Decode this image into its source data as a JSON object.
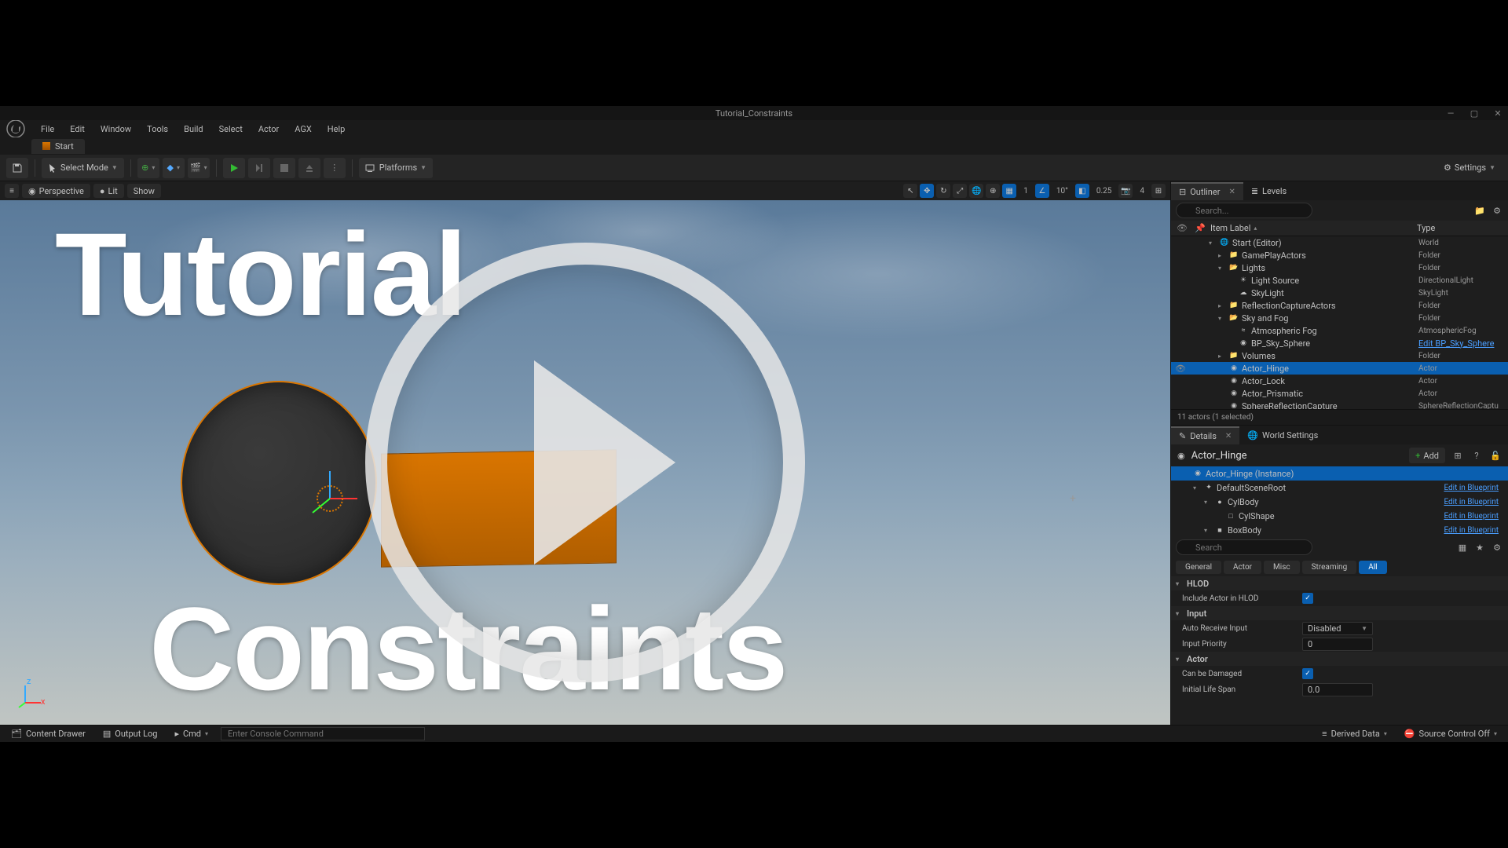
{
  "title": "Tutorial_Constraints",
  "menus": [
    "File",
    "Edit",
    "Window",
    "Tools",
    "Build",
    "Select",
    "Actor",
    "AGX",
    "Help"
  ],
  "level_tab": "Start",
  "toolbar": {
    "save_tip": "Save",
    "select_mode": "Select Mode",
    "platforms": "Platforms",
    "settings": "Settings"
  },
  "viewport": {
    "perspective": "Perspective",
    "lit": "Lit",
    "show": "Show",
    "snap_angle": "10°",
    "snap_scale": "0.25",
    "cams": "4",
    "grid": "1",
    "overlay_top": "Tutorial",
    "overlay_bottom": "Constraints"
  },
  "outliner": {
    "tab": "Outliner",
    "levels_tab": "Levels",
    "search_ph": "Search...",
    "col_item": "Item Label",
    "col_type": "Type",
    "rows": [
      {
        "d": 1,
        "exp": "▾",
        "icon": "world",
        "label": "Start (Editor)",
        "type": "World"
      },
      {
        "d": 2,
        "exp": "▸",
        "icon": "folder",
        "label": "GamePlayActors",
        "type": "Folder"
      },
      {
        "d": 2,
        "exp": "▾",
        "icon": "folder-open",
        "label": "Lights",
        "type": "Folder"
      },
      {
        "d": 3,
        "exp": "",
        "icon": "light",
        "label": "Light Source",
        "type": "DirectionalLight"
      },
      {
        "d": 3,
        "exp": "",
        "icon": "sky",
        "label": "SkyLight",
        "type": "SkyLight"
      },
      {
        "d": 2,
        "exp": "▸",
        "icon": "folder",
        "label": "ReflectionCaptureActors",
        "type": "Folder"
      },
      {
        "d": 2,
        "exp": "▾",
        "icon": "folder-open",
        "label": "Sky and Fog",
        "type": "Folder"
      },
      {
        "d": 3,
        "exp": "",
        "icon": "fog",
        "label": "Atmospheric Fog",
        "type": "AtmosphericFog"
      },
      {
        "d": 3,
        "exp": "",
        "icon": "sphere",
        "label": "BP_Sky_Sphere",
        "type": "Edit BP_Sky_Sphere",
        "link": true
      },
      {
        "d": 2,
        "exp": "▸",
        "icon": "folder",
        "label": "Volumes",
        "type": "Folder"
      },
      {
        "d": 2,
        "exp": "",
        "icon": "actor",
        "label": "Actor_Hinge",
        "type": "Actor",
        "selected": true,
        "eye": true
      },
      {
        "d": 2,
        "exp": "",
        "icon": "actor",
        "label": "Actor_Lock",
        "type": "Actor"
      },
      {
        "d": 2,
        "exp": "",
        "icon": "actor",
        "label": "Actor_Prismatic",
        "type": "Actor"
      },
      {
        "d": 2,
        "exp": "",
        "icon": "sphere",
        "label": "SphereReflectionCapture",
        "type": "SphereReflectionCaptu"
      }
    ],
    "status": "11 actors (1 selected)"
  },
  "details": {
    "tab": "Details",
    "world_tab": "World Settings",
    "actor": "Actor_Hinge",
    "add": "Add",
    "components": [
      {
        "d": 0,
        "label": "Actor_Hinge (Instance)",
        "sel": true,
        "link": ""
      },
      {
        "d": 1,
        "exp": "▾",
        "icon": "scene",
        "label": "DefaultSceneRoot",
        "link": "Edit in Blueprint"
      },
      {
        "d": 2,
        "exp": "▾",
        "icon": "cyl",
        "label": "CylBody",
        "link": "Edit in Blueprint"
      },
      {
        "d": 3,
        "exp": "",
        "icon": "shape",
        "label": "CylShape",
        "link": "Edit in Blueprint"
      },
      {
        "d": 2,
        "exp": "▾",
        "icon": "box",
        "label": "BoxBody",
        "link": "Edit in Blueprint"
      }
    ],
    "search_ph": "Search",
    "filters": [
      "General",
      "Actor",
      "Misc",
      "Streaming",
      "All"
    ],
    "filter_active": "All",
    "categories": [
      {
        "name": "HLOD",
        "props": [
          {
            "label": "Include Actor in HLOD",
            "type": "check",
            "val": true
          }
        ]
      },
      {
        "name": "Input",
        "props": [
          {
            "label": "Auto Receive Input",
            "type": "dd",
            "val": "Disabled"
          },
          {
            "label": "Input Priority",
            "type": "num",
            "val": "0"
          }
        ]
      },
      {
        "name": "Actor",
        "props": [
          {
            "label": "Can be Damaged",
            "type": "check",
            "val": true
          },
          {
            "label": "Initial Life Span",
            "type": "num",
            "val": "0.0"
          }
        ]
      }
    ]
  },
  "statusbar": {
    "content_drawer": "Content Drawer",
    "output_log": "Output Log",
    "cmd": "Cmd",
    "cmd_ph": "Enter Console Command",
    "derived": "Derived Data",
    "source_ctl": "Source Control Off"
  }
}
